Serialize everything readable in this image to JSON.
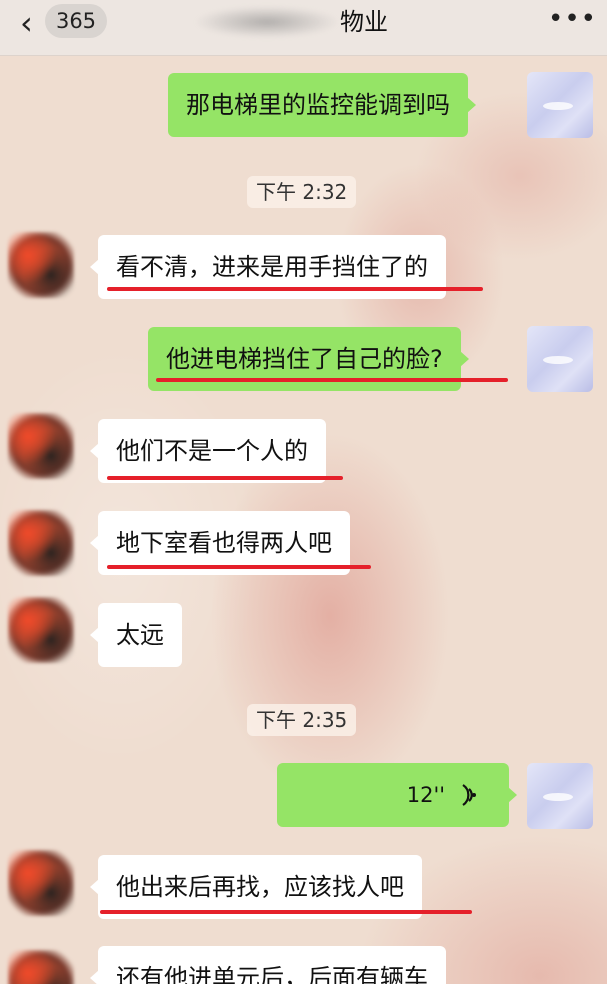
{
  "header": {
    "back_icon": "chevron-left-icon",
    "unread_count": "365",
    "title_suffix": "物业",
    "more_icon": "more-dots-icon"
  },
  "timestamps": [
    "下午 2:32",
    "下午 2:35"
  ],
  "messages": [
    {
      "sender": "me",
      "type": "text",
      "text": "那电梯里的监控能调到吗"
    },
    {
      "sender": "other",
      "type": "text",
      "text": "看不清，进来是用手挡住了的",
      "underlined": true
    },
    {
      "sender": "me",
      "type": "text",
      "text": "他进电梯挡住了自己的脸?",
      "underlined": true
    },
    {
      "sender": "other",
      "type": "text",
      "text": "他们不是一个人的",
      "underlined": true
    },
    {
      "sender": "other",
      "type": "text",
      "text": "地下室看也得两人吧",
      "underlined": true
    },
    {
      "sender": "other",
      "type": "text",
      "text": "太远"
    },
    {
      "sender": "me",
      "type": "voice",
      "duration": "12''",
      "icon": "voice-wave-icon"
    },
    {
      "sender": "other",
      "type": "text",
      "text": "他出来后再找，应该找人吧",
      "underlined": true
    },
    {
      "sender": "other",
      "type": "text",
      "text": "还有他进单元后，后面有辆车"
    }
  ],
  "colors": {
    "my_bubble": "#95e466",
    "other_bubble": "#ffffff",
    "underline": "#e5202a",
    "wallpaper": "#efddd0"
  }
}
